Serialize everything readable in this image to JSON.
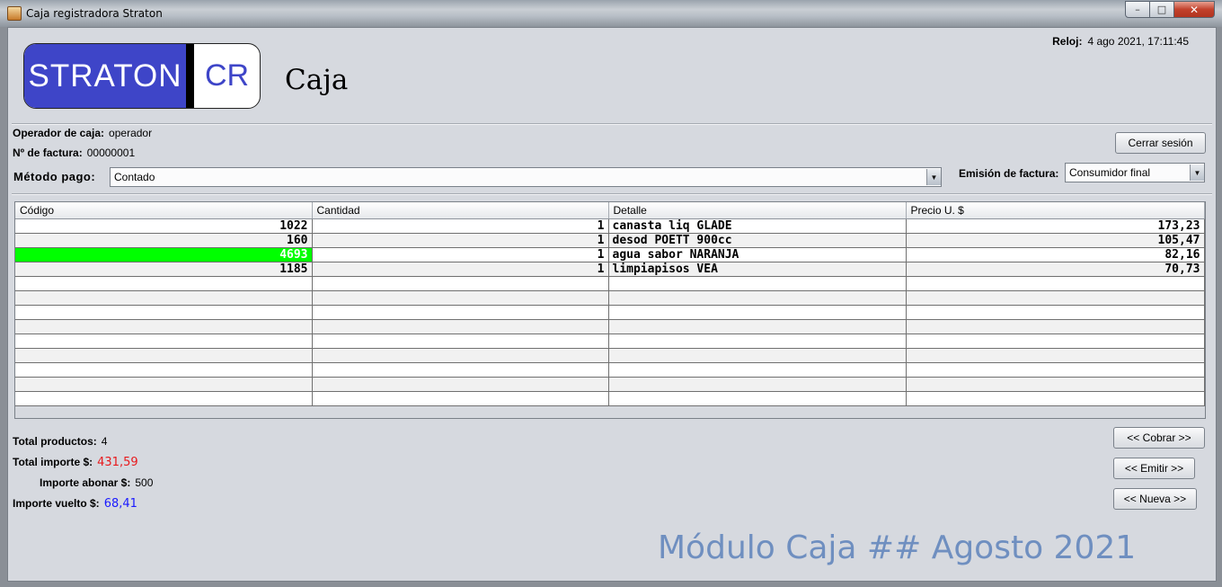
{
  "window": {
    "title": "Caja registradora Straton",
    "min_label": "–",
    "max_label": "□",
    "close_label": "✕"
  },
  "logo": {
    "left_text": "STRATON",
    "right_text": "CR"
  },
  "heading": "Caja",
  "clock": {
    "label": "Reloj:",
    "value": "4 ago 2021, 17:11:45"
  },
  "operador": {
    "label": "Operador de caja:",
    "value": "operador"
  },
  "factura": {
    "label": "Nº de factura:",
    "value": "00000001"
  },
  "cerrar_sesion": "Cerrar sesión",
  "metodo_pago": {
    "label": "Método pago:",
    "value": "Contado"
  },
  "emision": {
    "label": "Emisión de factura:",
    "value": "Consumidor final"
  },
  "table": {
    "headers": [
      "Código",
      "Cantidad",
      "Detalle",
      "Precio U. $"
    ],
    "rows": [
      [
        "1022",
        "1",
        "canasta liq GLADE",
        "173,23"
      ],
      [
        "160",
        "1",
        "desod POETT 900cc",
        "105,47"
      ],
      [
        "4693",
        "1",
        "agua sabor NARANJA",
        "82,16"
      ],
      [
        "1185",
        "1",
        "limpiapisos VEA",
        "70,73"
      ]
    ],
    "selected_row": 2,
    "empty_rows": 9
  },
  "totals": {
    "productos_label": "Total productos:",
    "productos_value": "4",
    "importe_label": "Total importe $:",
    "importe_value": "431,59",
    "abonar_label": "Importe abonar $:",
    "abonar_value": "500",
    "vuelto_label": "Importe vuelto $:",
    "vuelto_value": "68,41"
  },
  "buttons": {
    "cobrar": "<< Cobrar >>",
    "emitir": "<< Emitir >>",
    "nueva": "<< Nueva >>"
  },
  "footer": "Módulo Caja ## Agosto 2021",
  "colors": {
    "importe": "#e8191c",
    "vuelto": "#1a1aff",
    "selection": "#00ff00",
    "logo_blue": "#3e45c8",
    "footer": "#6f8fc0"
  }
}
